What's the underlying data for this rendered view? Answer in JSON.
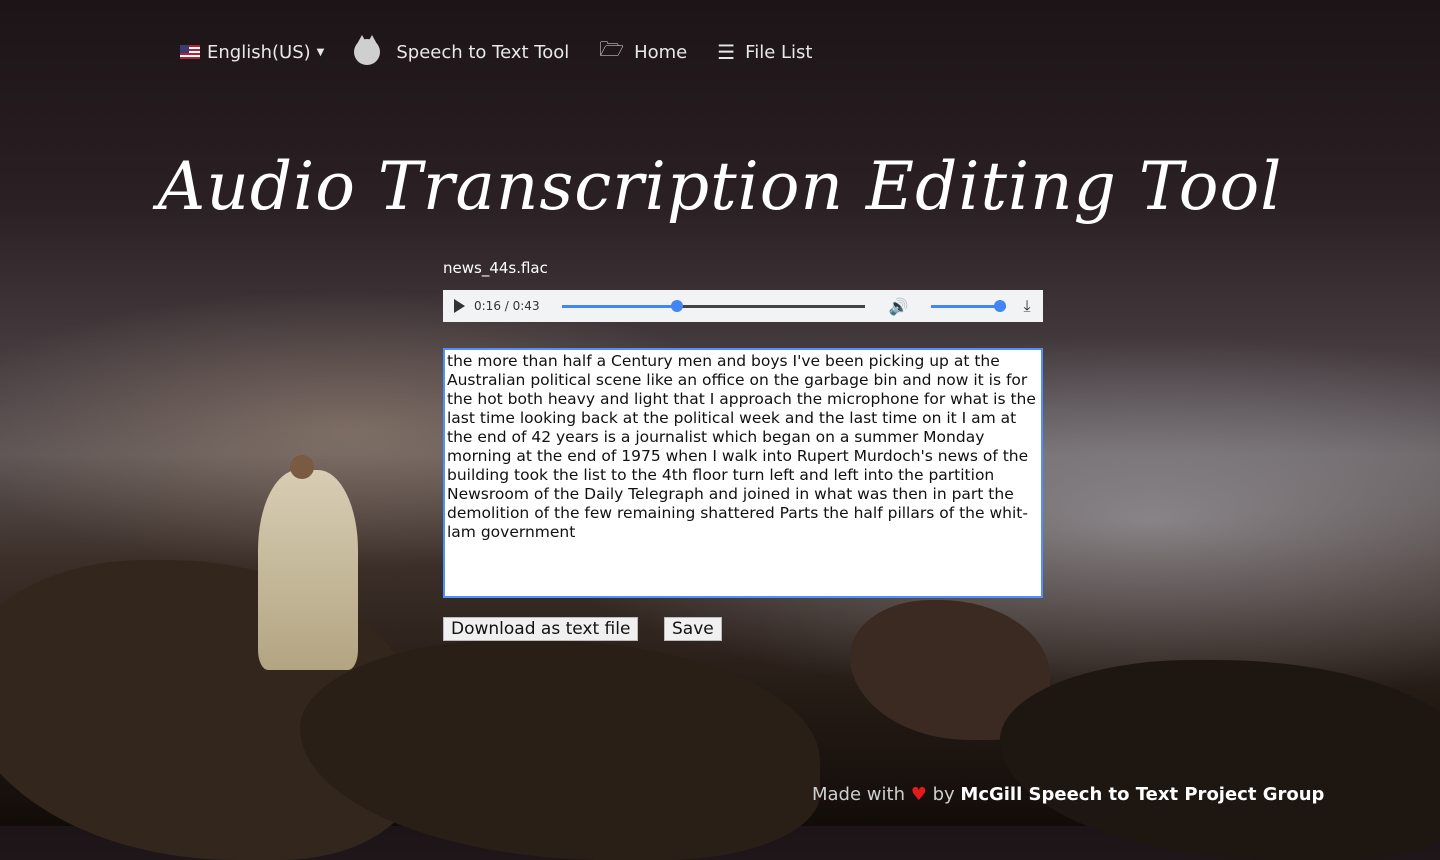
{
  "nav": {
    "language": "English(US)",
    "brand": "Speech to Text Tool",
    "home": "Home",
    "file_list": "File List"
  },
  "page": {
    "title": "Audio Transcription Editing Tool"
  },
  "audio": {
    "filename": "news_44s.flac",
    "current_time": "0:16",
    "duration": "0:43",
    "progress_fraction": 0.38,
    "volume_fraction": 0.93
  },
  "transcript": {
    "text": "the more than half a Century men and boys I've been picking up at the Australian political scene like an office on the garbage bin and now it is for the hot both heavy and light that I approach the microphone for what is the last time looking back at the political week and the last time on it I am at the end of 42 years is a journalist which began on a summer Monday morning at the end of 1975 when I walk into Rupert Murdoch's news of the building took the list to the 4th floor turn left and left into the partition Newsroom of the Daily Telegraph and joined in what was then in part the demolition of the few remaining shattered Parts the half pillars of the whit-lam government"
  },
  "buttons": {
    "download": "Download as text file",
    "save": "Save"
  },
  "footer": {
    "made_with": "Made with",
    "by": "by",
    "group": "McGill Speech to Text Project Group"
  },
  "colors": {
    "accent": "#4285f4",
    "heart": "#e41b1b"
  }
}
